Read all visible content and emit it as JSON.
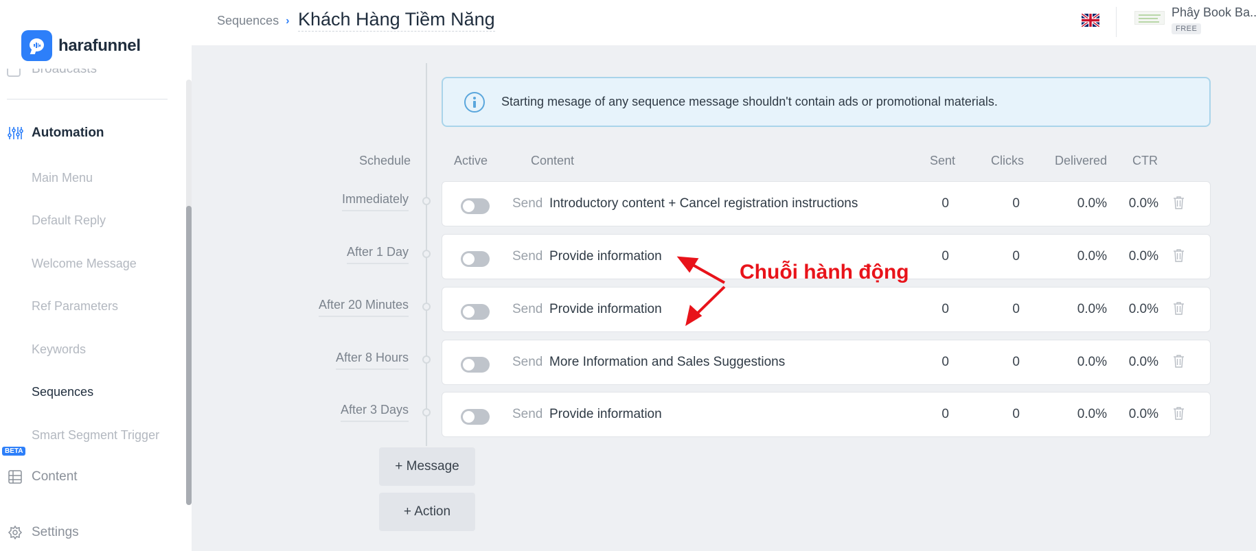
{
  "app": {
    "logo_text": "harafunnel"
  },
  "sidebar": {
    "clipped_item": "Broadcasts",
    "automation_label": "Automation",
    "sub_items": [
      "Main Menu",
      "Default Reply",
      "Welcome Message",
      "Ref Parameters",
      "Keywords",
      "Sequences",
      "Smart Segment Trigger"
    ],
    "active_sub_item": "Sequences",
    "beta_badge": "BETA",
    "content_label": "Content",
    "settings_label": "Settings"
  },
  "header": {
    "breadcrumb": "Sequences",
    "sequence_title": "Khách Hàng Tiềm Năng",
    "user_name": "Phây Book Ba...",
    "plan": "FREE",
    "language_flag": "uk-flag-icon"
  },
  "info_banner": {
    "text": "Starting mesage of any sequence message shouldn't contain ads or promotional materials."
  },
  "columns": {
    "schedule": "Schedule",
    "active": "Active",
    "content": "Content",
    "sent": "Sent",
    "clicks": "Clicks",
    "delivered": "Delivered",
    "ctr": "CTR"
  },
  "messages": [
    {
      "schedule": "Immediately",
      "active": false,
      "action": "Send",
      "content": "Introductory content + Cancel registration instructions",
      "sent": "0",
      "clicks": "0",
      "delivered": "0.0%",
      "ctr": "0.0%"
    },
    {
      "schedule": "After 1 Day",
      "active": false,
      "action": "Send",
      "content": "Provide information",
      "sent": "0",
      "clicks": "0",
      "delivered": "0.0%",
      "ctr": "0.0%"
    },
    {
      "schedule": "After 20 Minutes",
      "active": false,
      "action": "Send",
      "content": "Provide information",
      "sent": "0",
      "clicks": "0",
      "delivered": "0.0%",
      "ctr": "0.0%"
    },
    {
      "schedule": "After 8 Hours",
      "active": false,
      "action": "Send",
      "content": "More Information and Sales Suggestions",
      "sent": "0",
      "clicks": "0",
      "delivered": "0.0%",
      "ctr": "0.0%"
    },
    {
      "schedule": "After 3 Days",
      "active": false,
      "action": "Send",
      "content": "Provide information",
      "sent": "0",
      "clicks": "0",
      "delivered": "0.0%",
      "ctr": "0.0%"
    }
  ],
  "buttons": {
    "add_message": "+ Message",
    "add_action": "+ Action"
  },
  "annotation": {
    "text": "Chuỗi hành động",
    "color": "#e8131a"
  },
  "colors": {
    "accent": "#2d7ff9",
    "info_border": "#a9d4ea",
    "info_bg": "#e7f3fb"
  }
}
